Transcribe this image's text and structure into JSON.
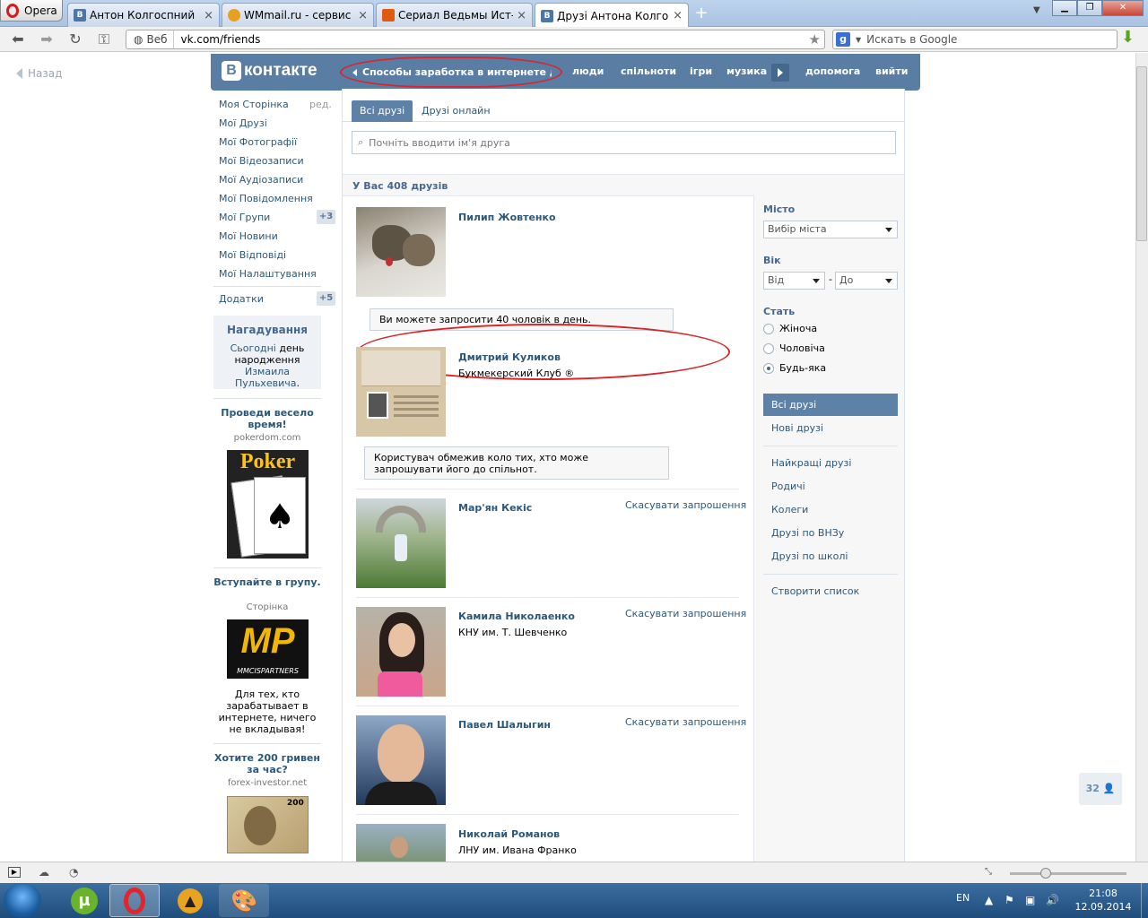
{
  "browser": {
    "app_label": "Opera",
    "tabs": [
      {
        "title": "Антон Колгоспний",
        "fav": "B",
        "color": "#4a76a8"
      },
      {
        "title": "WMmail.ru - сервис п...",
        "fav": "●",
        "color": "#e8a020"
      },
      {
        "title": "Сериал Ведьмы Ист-Э...",
        "fav": "▲",
        "color": "#e05a10"
      },
      {
        "title": "Друзі Антона Колгосп...",
        "fav": "B",
        "color": "#4a76a8"
      }
    ],
    "web_label": "Веб",
    "url": "vk.com/friends",
    "search_placeholder": "Искать в Google"
  },
  "page": {
    "back_label": "Назад",
    "logo_text": "контакте",
    "notice": "Способы заработка в интернете д...",
    "nav": [
      "люди",
      "спільноти",
      "ігри",
      "музика"
    ],
    "nav_right": [
      "допомога",
      "вийти"
    ],
    "left_menu": [
      {
        "label": "Моя Сторінка",
        "extra": "ред."
      },
      {
        "label": "Мої Друзі"
      },
      {
        "label": "Мої Фотографії"
      },
      {
        "label": "Мої Відеозаписи"
      },
      {
        "label": "Мої Аудіозаписи"
      },
      {
        "label": "Мої Повідомлення"
      },
      {
        "label": "Мої Групи",
        "badge": "+3"
      },
      {
        "label": "Мої Новини"
      },
      {
        "label": "Мої Відповіді"
      },
      {
        "label": "Мої Налаштування"
      }
    ],
    "apps_label": "Додатки",
    "apps_badge": "+5",
    "reminder": {
      "title": "Нагадування",
      "link1": "Сьогодні",
      "text1": "день народження",
      "link2": "Измаила Пульхевича",
      "end": "."
    },
    "ads": [
      {
        "title": "Проведи весело время!",
        "source": "pokerdom.com",
        "img": "Poker"
      },
      {
        "title": "Вступайте в групу.",
        "source": "Сторінка",
        "img": "MP",
        "img_sub": "MMCISPARTNERS",
        "text": "Для тех, кто зарабатывает в интернете, ничего не вкладывая!"
      },
      {
        "title": "Хотите 200 гривен за час?",
        "source": "forex-investor.net",
        "img": "200"
      }
    ],
    "tabs": {
      "all": "Всі друзі",
      "online": "Друзі онлайн"
    },
    "search_placeholder": "Почніть вводити ім'я друга",
    "count": "У Вас 408 друзів",
    "friends": [
      {
        "name": "Пилип Жовтенко",
        "sub": "",
        "action": "",
        "tip": "Ви можете запросити 40 чоловік в день."
      },
      {
        "name": "Дмитрий Куликов",
        "sub": "Букмекерский Клуб ®",
        "action": "",
        "tip": "Користувач обмежив коло тих, хто може запрошувати його до спільнот."
      },
      {
        "name": "Мар'ян Кекіс",
        "sub": "",
        "action": "Скасувати запрошення"
      },
      {
        "name": "Камила Николаенко",
        "sub": "КНУ им. Т. Шевченко",
        "action": "Скасувати запрошення"
      },
      {
        "name": "Павел Шалыгин",
        "sub": "",
        "action": "Скасувати запрошення"
      },
      {
        "name": "Николай Романов",
        "sub": "ЛНУ им. Ивана Франко",
        "action": ""
      }
    ],
    "filter": {
      "city_label": "Місто",
      "city_value": "Вибір міста",
      "age_label": "Вік",
      "age_from": "Від",
      "age_dash": "-",
      "age_to": "До",
      "sex_label": "Стать",
      "sex_options": [
        "Жіноча",
        "Чоловіча",
        "Будь-яка"
      ],
      "sex_selected": 2,
      "lists": [
        "Всі друзі",
        "Нові друзі"
      ],
      "lists2": [
        "Найкращі друзі",
        "Родичі",
        "Колеги",
        "Друзі по ВНЗу",
        "Друзі по школі"
      ],
      "create": "Створити список"
    },
    "online_count": "32"
  },
  "taskbar": {
    "lang": "EN",
    "time": "21:08",
    "date": "12.09.2014"
  }
}
